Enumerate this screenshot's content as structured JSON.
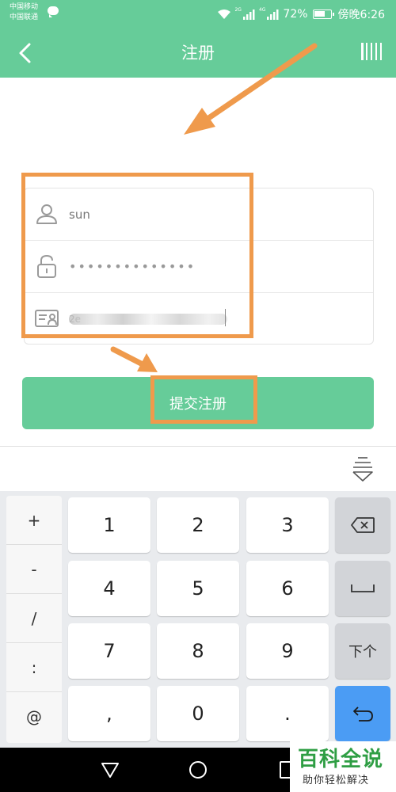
{
  "status_bar": {
    "carrier_1": "中国移动",
    "carrier_2": "中国联通",
    "net_1": "2G",
    "net_2": "4G",
    "battery": "72%",
    "battery_level": 0.72,
    "time": "傍晚6:26"
  },
  "header": {
    "title": "注册"
  },
  "form": {
    "username_value": "sun",
    "password_value": "••••••••••••••",
    "id_value": "2e"
  },
  "submit": {
    "label": "提交注册"
  },
  "keyboard": {
    "symbols": [
      "+",
      "-",
      "/",
      ":",
      "@"
    ],
    "digits": [
      [
        "1",
        "2",
        "3"
      ],
      [
        "4",
        "5",
        "6"
      ],
      [
        "7",
        "8",
        "9"
      ],
      [
        ",",
        "0",
        "."
      ]
    ],
    "next_label": "下个"
  },
  "watermark": {
    "title": "百科全说",
    "subtitle": "助你轻松解决"
  },
  "colors": {
    "brand_green": "#66cc99",
    "annotation_orange": "#ef9a4c",
    "enter_blue": "#4b9cf4"
  }
}
